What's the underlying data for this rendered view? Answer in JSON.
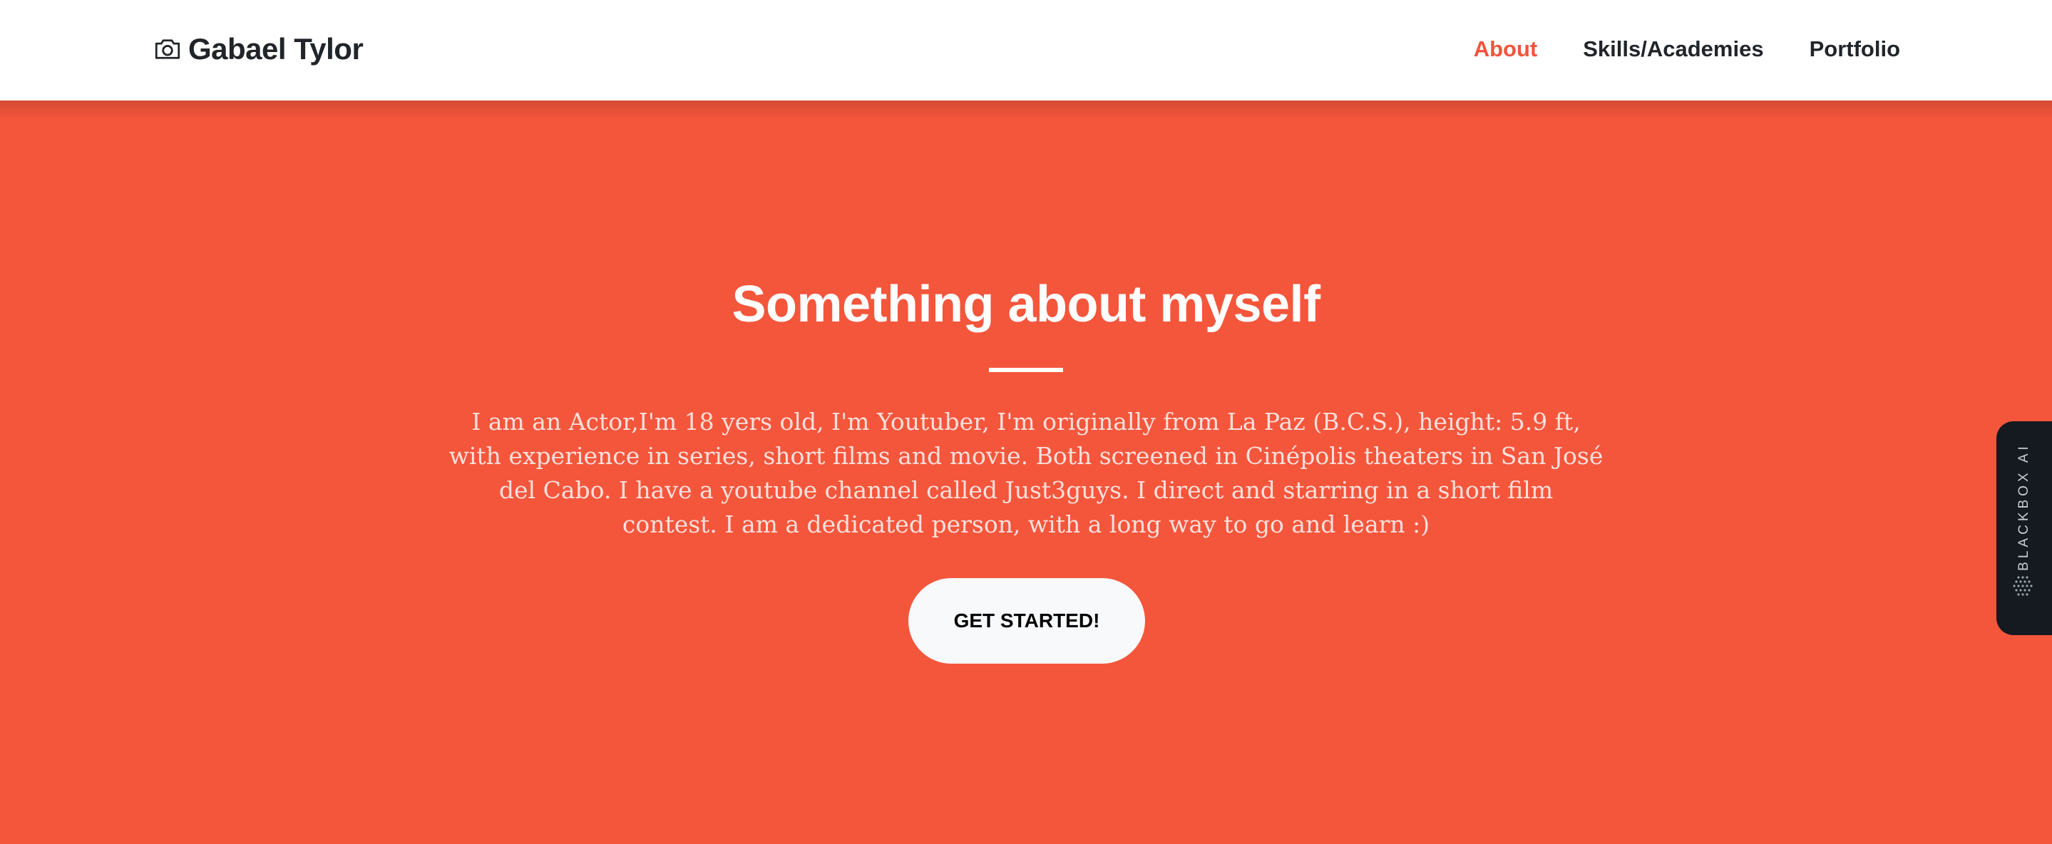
{
  "nav": {
    "brand": "Gabael Tylor",
    "brand_icon": "camera-icon",
    "links": [
      {
        "label": "About",
        "active": true
      },
      {
        "label": "Skills/Academies",
        "active": false
      },
      {
        "label": "Portfolio",
        "active": false
      }
    ]
  },
  "hero": {
    "title": "Something about myself",
    "text": "I am an Actor,I'm 18 yers old, I'm Youtuber, I'm originally from La Paz (B.C.S.), height: 5.9 ft, with experience in series, short films and movie. Both screened in Cinépolis theaters in San José del Cabo. I have a youtube channel called Just3guys. I direct and starring in a short film contest. I am a dedicated person, with a long way to go and learn :)",
    "cta_label": "GET STARTED!"
  },
  "side_tab": {
    "label": "BLACKBOX AI",
    "icon": "blackbox-logo-icon"
  },
  "colors": {
    "accent": "#f4563c",
    "nav_text": "#212529",
    "cta_bg": "#f8f9fa",
    "side_tab_bg": "#141a1f"
  }
}
